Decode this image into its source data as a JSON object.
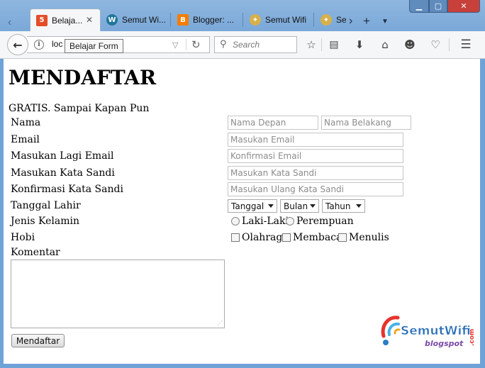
{
  "browser": {
    "tabs": [
      {
        "label": "Belaja...",
        "icon": "html5-icon",
        "active": true
      },
      {
        "label": "Semut Wi...",
        "icon": "wordpress-icon"
      },
      {
        "label": "Blogger: ...",
        "icon": "blogger-icon"
      },
      {
        "label": "Semut Wifi",
        "icon": "semut-icon"
      },
      {
        "label": "Ser",
        "icon": "semut-icon"
      }
    ],
    "new_tab_label": "+",
    "url_text": "loc",
    "tooltip": "Belajar Form",
    "search_placeholder": "Search",
    "colors": {
      "chrome": "#7aa8d8",
      "close_button": "#c7403a"
    }
  },
  "page": {
    "title": "MENDAFTAR",
    "subtitle": "GRATIS. Sampai Kapan Pun",
    "labels": {
      "name": "Nama",
      "email": "Email",
      "email_confirm": "Masukan Lagi Email",
      "password": "Masukan Kata Sandi",
      "password_confirm": "Konfirmasi Kata Sandi",
      "birth": "Tanggal Lahir",
      "gender": "Jenis Kelamin",
      "hobby": "Hobi",
      "comment": "Komentar"
    },
    "placeholders": {
      "first_name": "Nama Depan",
      "last_name": "Nama Belakang",
      "email": "Masukan Email",
      "email_confirm": "Konfirmasi Email",
      "password": "Masukan Kata Sandi",
      "password_confirm": "Masukan Ulang Kata Sandi"
    },
    "selects": {
      "day": "Tanggal",
      "month": "Bulan",
      "year": "Tahun"
    },
    "gender_options": [
      "Laki-Laki",
      "Perempuan"
    ],
    "hobby_options": [
      "Olahraga",
      "Membaca",
      "Menulis"
    ],
    "submit_label": "Mendaftar",
    "logo": {
      "main": "SemutWifi",
      "sub": "blogspot",
      "suffix": ".com"
    }
  }
}
